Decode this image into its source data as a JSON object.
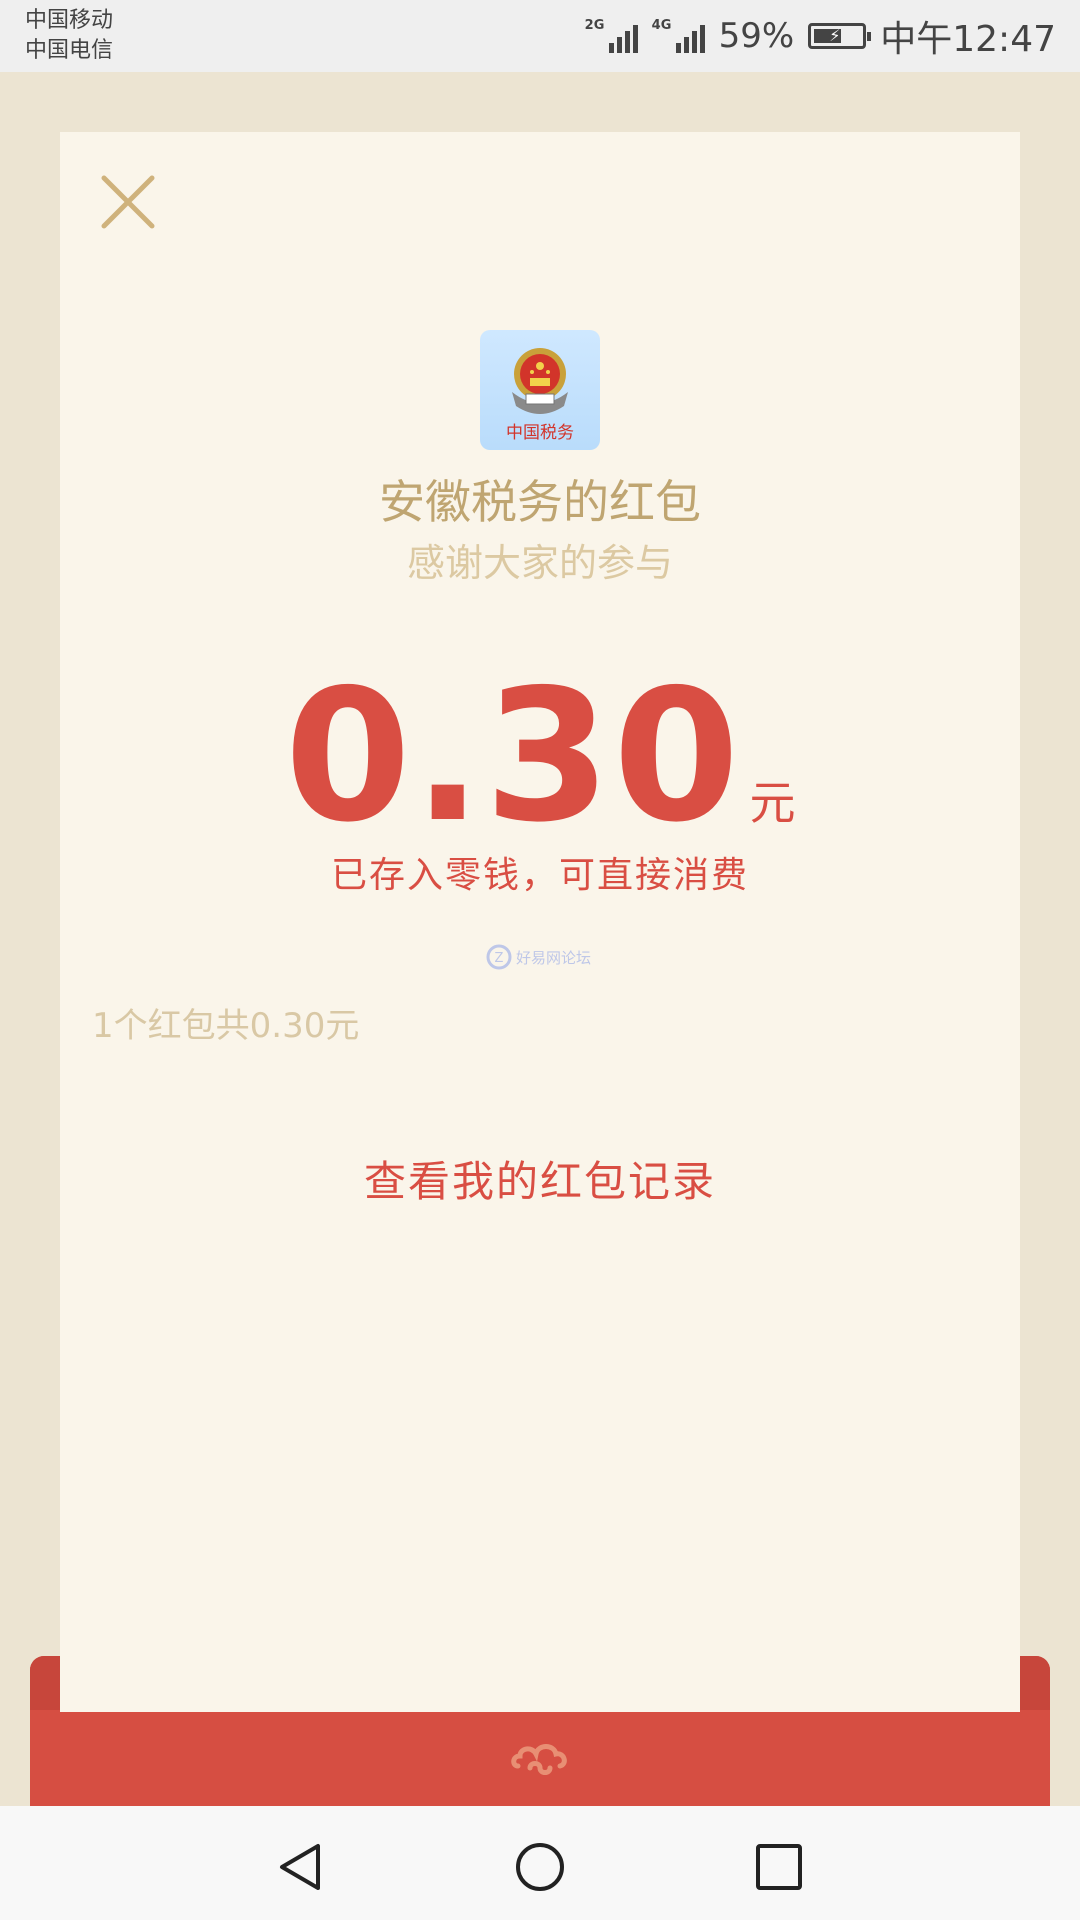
{
  "status_bar": {
    "carrier_1": "中国移动",
    "carrier_2": "中国电信",
    "signal_1_tag": "2G",
    "signal_2_tag": "4G",
    "battery_percent": "59%",
    "battery_level": 0.59,
    "time": "中午12:47"
  },
  "card": {
    "close_icon": "close-icon",
    "logo_icon": "china-tax-emblem-icon",
    "logo_caption": "中国税务",
    "title": "安徽税务的红包",
    "subtitle": "感谢大家的参与",
    "amount": "0.30",
    "unit": "元",
    "stored_message": "已存入零钱，可直接消费",
    "watermark_text": "好易网论坛",
    "summary": "1个红包共0.30元",
    "records_link": "查看我的红包记录"
  },
  "envelope": {
    "icon": "cloud-icon"
  },
  "nav_bar": {
    "back_icon": "back-triangle-icon",
    "home_icon": "home-circle-icon",
    "recent_icon": "recent-square-icon"
  },
  "colors": {
    "page_bg": "#ECE4D2",
    "card_bg": "#FAF5EA",
    "accent_red": "#D94E43",
    "gold": "#BFA571",
    "light_gold": "#DCC9A2"
  }
}
